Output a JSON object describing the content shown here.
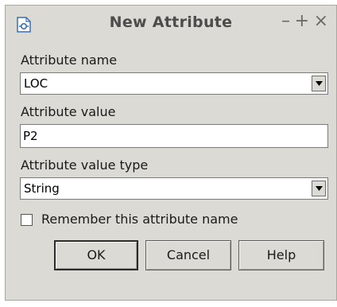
{
  "window": {
    "title": "New Attribute",
    "minimize_glyph": "–",
    "maximize_glyph": "+",
    "close_glyph": "×"
  },
  "form": {
    "name_label": "Attribute name",
    "name_value": "LOC",
    "value_label": "Attribute value",
    "value_value": "P2",
    "type_label": "Attribute value type",
    "type_value": "String",
    "remember_label": "Remember this attribute name",
    "remember_checked": false
  },
  "buttons": {
    "ok": "OK",
    "cancel": "Cancel",
    "help": "Help"
  },
  "icons": {
    "app": "attribute-app-icon",
    "dropdown": "chevron-down-icon"
  },
  "colors": {
    "dialog_bg": "#dcdad5",
    "title_text": "#4c4c4c"
  }
}
